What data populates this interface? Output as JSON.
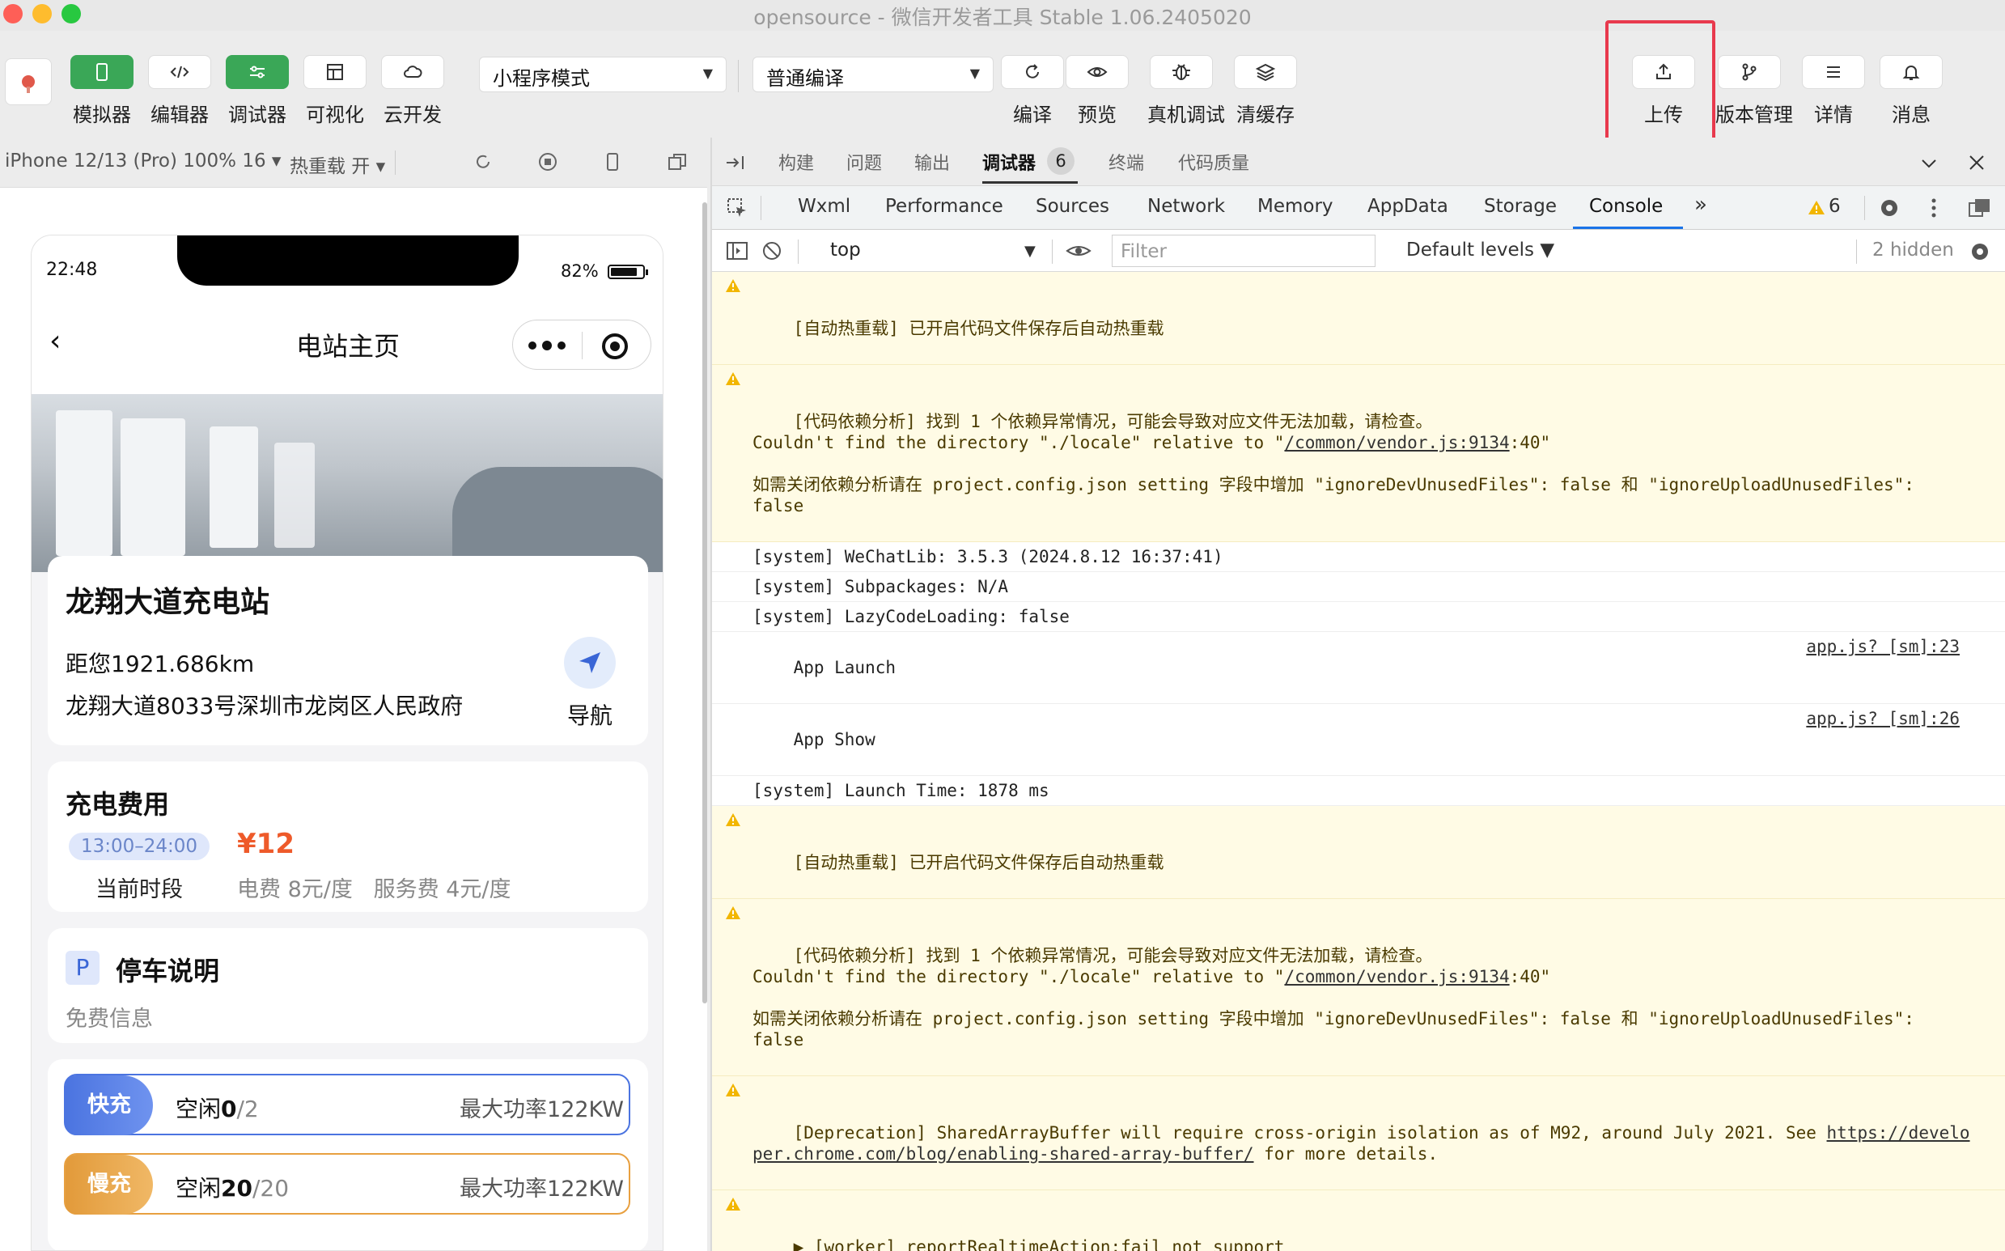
{
  "window": {
    "title_app": "opensource",
    "title_sep": " - ",
    "title_suffix": "微信开发者工具 Stable 1.06.2405020"
  },
  "toolbar": {
    "simulator": "模拟器",
    "editor": "编辑器",
    "debugger": "调试器",
    "visualize": "可视化",
    "cloud": "云开发",
    "mode_select": "小程序模式",
    "compile_select": "普通编译",
    "compile": "编译",
    "preview": "预览",
    "remote_debug": "真机调试",
    "clear_cache": "清缓存",
    "upload": "上传",
    "version_mgmt": "版本管理",
    "details": "详情",
    "messages": "消息"
  },
  "simbar": {
    "device": "iPhone 12/13 (Pro) 100% 16",
    "hot_reload": "热重载 开"
  },
  "phone": {
    "time": "22:48",
    "battery": "82%",
    "nav_title": "电站主页",
    "station": {
      "name": "龙翔大道充电站",
      "distance": "距您1921.686km",
      "address": "龙翔大道8033号深圳市龙岗区人民政府",
      "nav_label": "导航"
    },
    "fee": {
      "title": "充电费用",
      "time_range": "13:00–24:00",
      "period_label": "当前时段",
      "price": "¥12",
      "detail": "电费 8元/度   服务费 4元/度"
    },
    "parking": {
      "icon": "P",
      "title": "停车说明",
      "subtitle": "免费信息"
    },
    "chargers": [
      {
        "tag": "快充",
        "free_label": "空闲",
        "free": "0",
        "total": "/2",
        "power": "最大功率122KW",
        "color": "#4b74e0"
      },
      {
        "tag": "慢充",
        "free_label": "空闲",
        "free": "20",
        "total": "/20",
        "power": "最大功率122KW",
        "color": "#e8a040"
      }
    ]
  },
  "devtools": {
    "top_tabs": {
      "build": "构建",
      "issues": "问题",
      "output": "输出",
      "debugger": "调试器",
      "debugger_count": "6",
      "terminal": "终端",
      "quality": "代码质量"
    },
    "panel_tabs": {
      "wxml": "Wxml",
      "performance": "Performance",
      "sources": "Sources",
      "network": "Network",
      "memory": "Memory",
      "appdata": "AppData",
      "storage": "Storage",
      "console": "Console",
      "warn_count": "6"
    },
    "filterbar": {
      "context": "top",
      "filter_placeholder": "Filter",
      "levels": "Default levels",
      "hidden": "2 hidden"
    },
    "logs": [
      {
        "level": "warn",
        "text": "[自动热重载] 已开启代码文件保存后自动热重载"
      },
      {
        "level": "warn",
        "text": "[代码依赖分析] 找到 1 个依赖异常情况，可能会导致对应文件无法加载，请检查。\nCouldn't find the directory \"./locale\" relative to \"",
        "link": "/common/vendor.js:9134",
        "tail": ":40\"\n\n如需关闭依赖分析请在 project.config.json setting 字段中增加 \"ignoreDevUnusedFiles\": false 和 \"ignoreUploadUnusedFiles\":\nfalse"
      },
      {
        "level": "info",
        "text": "[system] WeChatLib: 3.5.3 (2024.8.12 16:37:41)"
      },
      {
        "level": "info",
        "text": "[system] Subpackages: N/A"
      },
      {
        "level": "info",
        "text": "[system] LazyCodeLoading: false"
      },
      {
        "level": "info",
        "text": "App Launch",
        "src": "app.js? [sm]:23"
      },
      {
        "level": "info",
        "text": "App Show",
        "src": "app.js? [sm]:26"
      },
      {
        "level": "info",
        "text": "[system] Launch Time: 1878 ms"
      },
      {
        "level": "warn",
        "text": "[自动热重载] 已开启代码文件保存后自动热重载"
      },
      {
        "level": "warn",
        "text": "[代码依赖分析] 找到 1 个依赖异常情况，可能会导致对应文件无法加载，请检查。\nCouldn't find the directory \"./locale\" relative to \"",
        "link": "/common/vendor.js:9134",
        "tail": ":40\"\n\n如需关闭依赖分析请在 project.config.json setting 字段中增加 \"ignoreDevUnusedFiles\": false 和 \"ignoreUploadUnusedFiles\":\nfalse"
      },
      {
        "level": "warn",
        "text": "[Deprecation] SharedArrayBuffer will require cross-origin isolation as of M92, around July 2021. See ",
        "link": "https://developer.chrome.com/blog/enabling-shared-array-buffer/",
        "tail": " for more details."
      },
      {
        "level": "warn",
        "text": "▶ [worker] reportRealtimeAction:fail not support"
      }
    ],
    "prompt": ">"
  }
}
